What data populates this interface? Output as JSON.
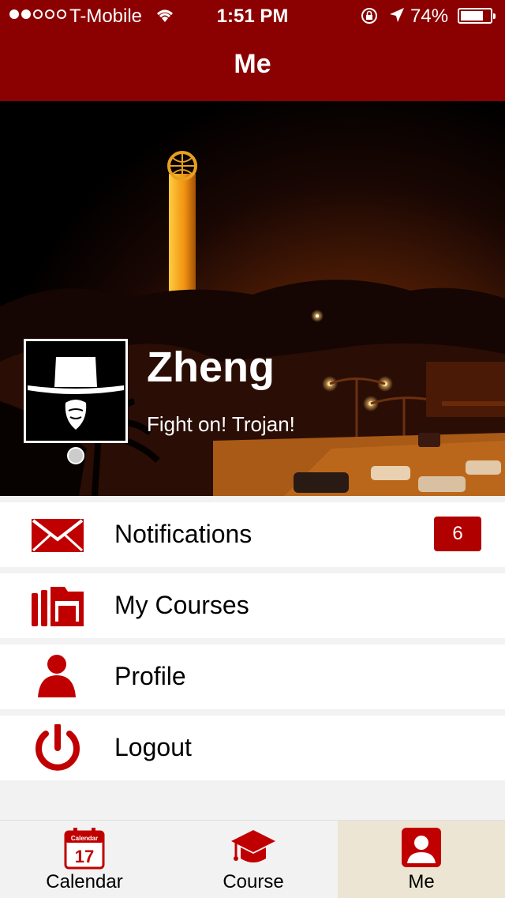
{
  "status_bar": {
    "carrier": "T-Mobile",
    "time": "1:51 PM",
    "battery": "74%",
    "signal_level": 2
  },
  "nav": {
    "title": "Me"
  },
  "profile": {
    "name": "Zheng",
    "motto": "Fight on! Trojan!"
  },
  "menu": [
    {
      "label": "Notifications",
      "icon": "envelope-icon",
      "badge": "6"
    },
    {
      "label": "My Courses",
      "icon": "folder-icon"
    },
    {
      "label": "Profile",
      "icon": "person-icon"
    },
    {
      "label": "Logout",
      "icon": "power-icon"
    }
  ],
  "tabs": [
    {
      "label": "Calendar",
      "icon": "calendar-icon",
      "icon_text_top": "Calendar",
      "icon_text_num": "17"
    },
    {
      "label": "Course",
      "icon": "graduation-cap-icon"
    },
    {
      "label": "Me",
      "icon": "profile-card-icon",
      "active": true
    }
  ],
  "colors": {
    "brand": "#8b0000",
    "accent": "#b00000",
    "active_tab": "#ece5d4"
  }
}
